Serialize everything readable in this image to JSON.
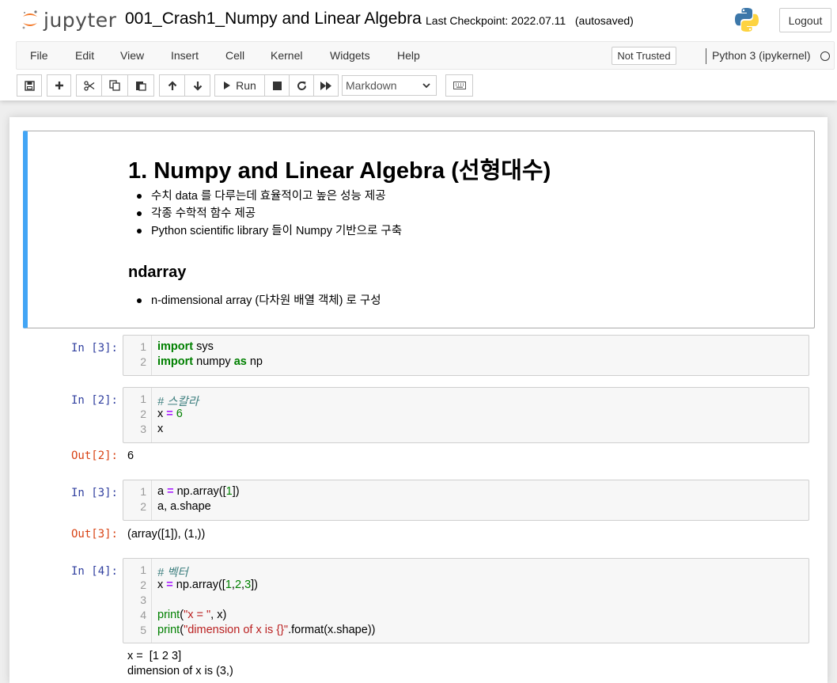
{
  "header": {
    "logo_text": "jupyter",
    "notebook_title": "001_Crash1_Numpy and Linear Algebra",
    "checkpoint": "Last Checkpoint: 2022.07.11   (autosaved)",
    "logout_label": "Logout"
  },
  "menubar": {
    "items": [
      "File",
      "Edit",
      "View",
      "Insert",
      "Cell",
      "Kernel",
      "Widgets",
      "Help"
    ],
    "trust_label": "Not Trusted",
    "kernel_name": "Python 3 (ipykernel)"
  },
  "toolbar": {
    "run_label": "Run",
    "cell_type": "Markdown",
    "icons": [
      "save-icon",
      "plus-icon",
      "cut-icon",
      "copy-icon",
      "paste-icon",
      "arrow-up-icon",
      "arrow-down-icon",
      "run-icon",
      "stop-icon",
      "restart-icon",
      "fast-forward-icon",
      "keyboard-icon"
    ]
  },
  "colors": {
    "accent_blue": "#42a5f5",
    "prompt_in": "#303f9f",
    "prompt_out": "#d84315",
    "keyword": "#008000",
    "operator": "#aa22ff",
    "string": "#ba2121",
    "comment": "#408080"
  },
  "markdown_cell": {
    "h1": "1. Numpy and Linear Algebra (선형대수)",
    "bullets1": [
      "수치 data 를 다루는데 효율적이고 높은 성능 제공",
      "각종 수학적 함수 제공",
      "Python scientific library 들이 Numpy 기반으로 구축"
    ],
    "h2": "ndarray",
    "bullets2": [
      "n-dimensional array (다차원 배열 객체) 로 구성"
    ]
  },
  "cells": [
    {
      "prompt": "In [3]:",
      "lines": [
        [
          [
            "kw",
            "import"
          ],
          [
            "",
            " sys"
          ]
        ],
        [
          [
            "kw",
            "import"
          ],
          [
            "",
            " numpy "
          ],
          [
            "kw",
            "as"
          ],
          [
            "",
            " np"
          ]
        ]
      ]
    },
    {
      "prompt": "In [2]:",
      "lines": [
        [
          [
            "cm",
            "# 스칼라"
          ]
        ],
        [
          [
            "",
            "x "
          ],
          [
            "op",
            "="
          ],
          [
            "",
            " "
          ],
          [
            "num",
            "6"
          ]
        ],
        [
          [
            "",
            "x"
          ]
        ]
      ],
      "out_prompt": "Out[2]:",
      "output": "6"
    },
    {
      "prompt": "In [3]:",
      "lines": [
        [
          [
            "",
            "a "
          ],
          [
            "op",
            "="
          ],
          [
            "",
            " np.array(["
          ],
          [
            "num",
            "1"
          ],
          [
            "",
            "])"
          ]
        ],
        [
          [
            "",
            "a, a.shape"
          ]
        ]
      ],
      "out_prompt": "Out[3]:",
      "output": "(array([1]), (1,))"
    },
    {
      "prompt": "In [4]:",
      "lines": [
        [
          [
            "cm",
            "# 벡터"
          ]
        ],
        [
          [
            "",
            "x "
          ],
          [
            "op",
            "="
          ],
          [
            "",
            " np.array(["
          ],
          [
            "num",
            "1"
          ],
          [
            "",
            ","
          ],
          [
            "num",
            "2"
          ],
          [
            "",
            ","
          ],
          [
            "num",
            "3"
          ],
          [
            "",
            "])"
          ]
        ],
        [],
        [
          [
            "bi",
            "print"
          ],
          [
            "",
            "("
          ],
          [
            "str",
            "\"x = \""
          ],
          [
            "",
            ", x)"
          ]
        ],
        [
          [
            "bi",
            "print"
          ],
          [
            "",
            "("
          ],
          [
            "str",
            "\"dimension of x is {}\""
          ],
          [
            "",
            ".format(x.shape))"
          ]
        ]
      ],
      "output_lines": [
        "x =  [1 2 3]",
        "dimension of x is (3,)"
      ]
    }
  ]
}
